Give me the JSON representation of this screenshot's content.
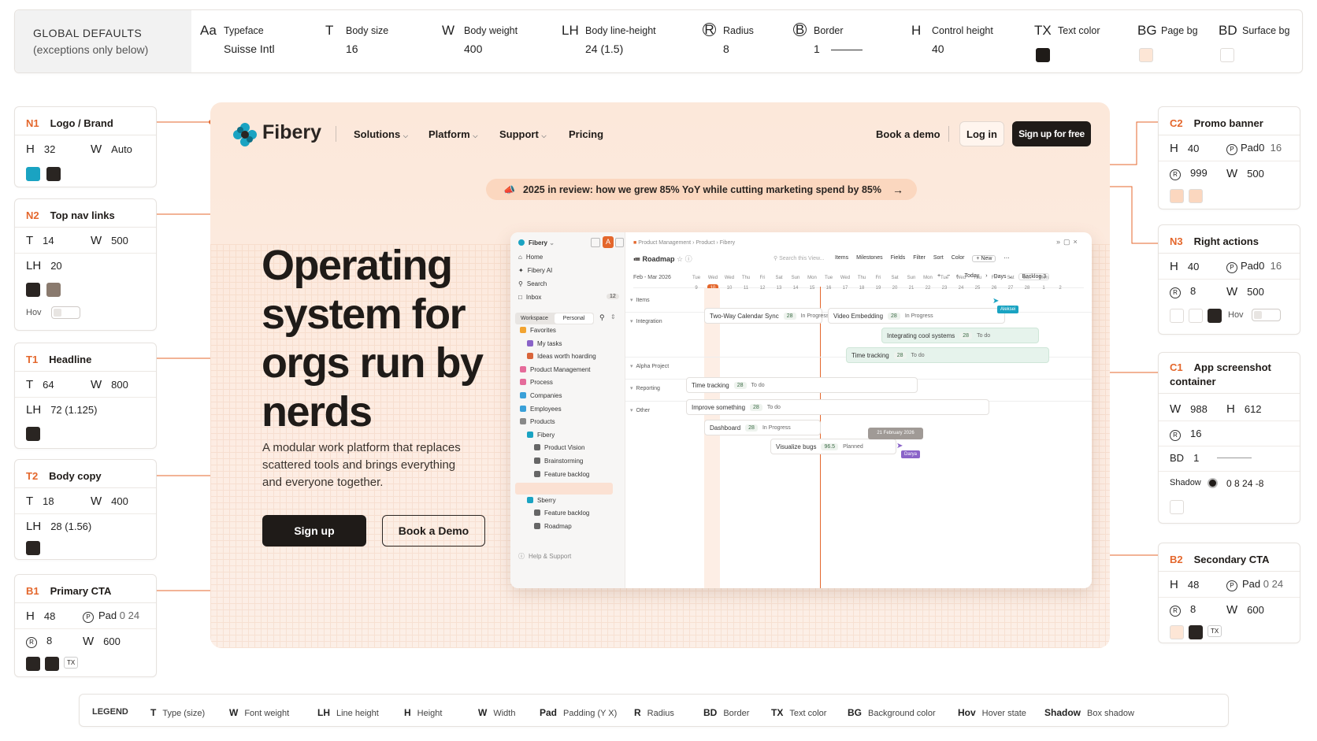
{
  "global": {
    "title": "GLOBAL DEFAULTS",
    "subtitle": "(exceptions only below)",
    "items": [
      {
        "icon": "Aa",
        "label": "Typeface",
        "value": "Suisse Intl"
      },
      {
        "icon": "T",
        "label": "Body size",
        "value": "16"
      },
      {
        "icon": "W",
        "label": "Body weight",
        "value": "400"
      },
      {
        "icon": "LH",
        "label": "Body line-height",
        "value": "24 (1.5)"
      },
      {
        "icon": "R",
        "label": "Radius",
        "value": "8"
      },
      {
        "icon": "B",
        "label": "Border",
        "value": "1"
      },
      {
        "icon": "H",
        "label": "Control height",
        "value": "40"
      },
      {
        "icon": "TX",
        "label": "Text color",
        "swatch": "#1f1b18"
      },
      {
        "icon": "BG",
        "label": "Page bg",
        "swatch": "#fde6d6"
      },
      {
        "icon": "BD",
        "label": "Surface bg",
        "swatch": "#ffffff"
      }
    ]
  },
  "specs": {
    "n1": {
      "code": "N1",
      "name": "Logo / Brand",
      "h": "32",
      "w": "Auto",
      "colors": [
        "#1aa3c2",
        "#2a2522"
      ]
    },
    "n2": {
      "code": "N2",
      "name": "Top nav links",
      "t": "14",
      "w": "500",
      "lh": "20",
      "colors": [
        "#2a2522",
        "#8a7a6e"
      ],
      "hov": "Hov"
    },
    "t1": {
      "code": "T1",
      "name": "Headline",
      "t": "64",
      "w": "800",
      "lh": "72",
      "lh2": "(1.125)",
      "colors": [
        "#2a2522"
      ]
    },
    "t2": {
      "code": "T2",
      "name": "Body copy",
      "t": "18",
      "w": "400",
      "lh": "28",
      "lh2": "(1.56)",
      "colors": [
        "#2a2522"
      ]
    },
    "b1": {
      "code": "B1",
      "name": "Primary CTA",
      "h": "48",
      "pad": "Pad",
      "padv": "0  24",
      "r": "8",
      "w": "600",
      "colors": [
        "#2a2522",
        "#2a2522"
      ],
      "tx": "TX"
    },
    "c2": {
      "code": "C2",
      "name": "Promo banner",
      "h": "40",
      "pad": "Pad0",
      "padv": "16",
      "r": "999",
      "w": "500",
      "colors": [
        "#fbd7bf",
        "#fbd7bf"
      ]
    },
    "n3": {
      "code": "N3",
      "name": "Right actions",
      "h": "40",
      "pad": "Pad0",
      "padv": "16",
      "r": "8",
      "w": "500",
      "colors": [
        "#ffffff",
        "#ffffff",
        "#2a2522"
      ],
      "hov": "Hov"
    },
    "c1": {
      "code": "C1",
      "name": "App screenshot container",
      "w": "988",
      "h": "612",
      "r": "16",
      "bd": "1",
      "shadow_label": "Shadow",
      "shadow": "0  8 24  -8",
      "colors": [
        "#ffffff"
      ]
    },
    "b2": {
      "code": "B2",
      "name": "Secondary CTA",
      "h": "48",
      "pad": "Pad",
      "padv": "0  24",
      "r": "8",
      "w": "600",
      "colors": [
        "#fde6d6",
        "#2a2522"
      ],
      "tx": "TX"
    }
  },
  "hero": {
    "brand": "Fibery",
    "nav": [
      "Solutions",
      "Platform",
      "Support",
      "Pricing"
    ],
    "book_demo": "Book a demo",
    "login": "Log in",
    "signup_free": "Sign up for free",
    "promo": "2025 in review: how we grew 85% YoY while cutting marketing spend by 85%",
    "headline": [
      "Operating",
      "system for",
      "orgs run by",
      "nerds"
    ],
    "body": [
      "A modular work platform that replaces",
      "scattered tools and brings everything",
      "and everyone together."
    ],
    "cta_primary": "Sign up",
    "cta_secondary": "Book a Demo"
  },
  "app": {
    "workspace": "Fibery",
    "side_top": [
      "Home",
      "Fibery AI",
      "Search",
      "Inbox"
    ],
    "inbox_count": "12",
    "tabs": [
      "Workspace",
      "Personal"
    ],
    "side_tree": [
      "Favorites",
      "My tasks",
      "Ideas worth hoarding",
      "Product Management",
      "Process",
      "Companies",
      "Employees",
      "Products",
      "Fibery",
      "Product Vision",
      "Brainstorming",
      "Feature backlog",
      "Roadmap",
      "Sberry",
      "Feature backlog",
      "Roadmap"
    ],
    "help": "Help & Support",
    "breadcrumb": [
      "Product Management",
      "Product",
      "Fibery"
    ],
    "view_title": "Roadmap",
    "search_ph": "Search this View...",
    "toolbar": [
      "Items",
      "Milestones",
      "Fields",
      "Filter",
      "Sort",
      "Color",
      "+ New"
    ],
    "range": "Feb - Mar 2026",
    "today": "Today",
    "days": "Days",
    "backlog": "Backlog",
    "backlog_count": "3",
    "groups": [
      "Items",
      "Integration",
      "Alpha Project",
      "Reporting",
      "Other"
    ],
    "day_names": [
      "Tue",
      "Wed",
      "Wed",
      "Thu",
      "Fri",
      "Sat",
      "Sun",
      "Mon",
      "Tue",
      "Wed",
      "Thu",
      "Fri",
      "Sat",
      "Sun",
      "Mon",
      "Tue",
      "Wed",
      "Thu",
      "Fri",
      "Sat",
      "Sun",
      "Mon"
    ],
    "day_nums": [
      "9",
      "10",
      "10",
      "11",
      "12",
      "13",
      "14",
      "15",
      "16",
      "17",
      "18",
      "19",
      "20",
      "21",
      "22",
      "23",
      "24",
      "25",
      "26",
      "27",
      "28",
      "1",
      "2"
    ],
    "tasks": [
      {
        "name": "Two-Way Calendar Sync",
        "n": "28",
        "s": "In Progress"
      },
      {
        "name": "Video Embedding",
        "n": "28",
        "s": "In Progress"
      },
      {
        "name": "Integrating cool systems",
        "n": "28",
        "s": "To do"
      },
      {
        "name": "Time tracking",
        "n": "28",
        "s": "To do"
      },
      {
        "name": "Time tracking",
        "n": "28",
        "s": "To do"
      },
      {
        "name": "Improve something",
        "n": "28",
        "s": "To do"
      },
      {
        "name": "Dashboard",
        "n": "28",
        "s": "In Progress"
      },
      {
        "name": "Visualize bugs",
        "n": "96.5",
        "s": "Planned"
      }
    ],
    "date_tip": "21 February 2026",
    "cursor1": "Aleksei",
    "cursor2": "Darya"
  },
  "legend": {
    "title": "LEGEND",
    "items": [
      {
        "k": "T",
        "v": "Type (size)"
      },
      {
        "k": "W",
        "v": "Font weight"
      },
      {
        "k": "LH",
        "v": "Line height"
      },
      {
        "k": "H",
        "v": "Height"
      },
      {
        "k": "W",
        "v": "Width"
      },
      {
        "k": "Pad",
        "v": "Padding (Y X)"
      },
      {
        "k": "R",
        "v": "Radius"
      },
      {
        "k": "BD",
        "v": "Border"
      },
      {
        "k": "TX",
        "v": "Text color"
      },
      {
        "k": "BG",
        "v": "Background color"
      },
      {
        "k": "Hov",
        "v": "Hover state"
      },
      {
        "k": "Shadow",
        "v": "Box shadow"
      }
    ]
  }
}
